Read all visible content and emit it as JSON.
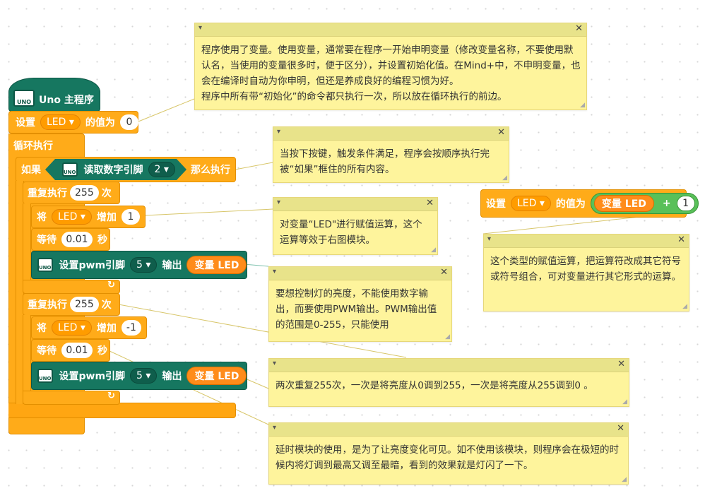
{
  "program": {
    "hat_title": "Uno 主程序",
    "board_label": "UNO",
    "set_var": {
      "set": "设置",
      "var": "LED",
      "value_of": "的值为",
      "value": "0"
    },
    "loop_label": "循环执行",
    "if_block": {
      "if": "如果",
      "read_digital": "读取数字引脚",
      "pin": "2",
      "then": "那么执行"
    },
    "repeat1": {
      "repeat": "重复执行",
      "count": "255",
      "times": "次",
      "change": {
        "label": "将",
        "var": "LED",
        "increase": "增加",
        "by": "1"
      },
      "wait": {
        "label": "等待",
        "value": "0.01",
        "unit": "秒"
      },
      "pwm": {
        "label": "设置pwm引脚",
        "pin": "5",
        "output": "输出",
        "var_reporter": "变量 LED"
      }
    },
    "repeat2": {
      "repeat": "重复执行",
      "count": "255",
      "times": "次",
      "change": {
        "label": "将",
        "var": "LED",
        "increase": "增加",
        "by": "-1"
      },
      "wait": {
        "label": "等待",
        "value": "0.01",
        "unit": "秒"
      },
      "pwm": {
        "label": "设置pwm引脚",
        "pin": "5",
        "output": "输出",
        "var_reporter": "变量 LED"
      }
    },
    "loop_arrow": "↻"
  },
  "standalone": {
    "set": "设置",
    "var": "LED",
    "value_of": "的值为",
    "var_reporter": "变量 LED",
    "op": "+",
    "num": "1"
  },
  "comments": {
    "c1": "程序使用了变量。使用变量，通常要在程序一开始申明变量（修改变量名称，不要使用默认名，当使用的变量很多时，便于区分），并设置初始化值。在Mind+中，不申明变量，也会在编译时自动为你申明，但还是养成良好的编程习惯为好。\n程序中所有带“初始化”的命令都只执行一次，所以放在循环执行的前边。",
    "c2": "当按下按键，触发条件满足，程序会按顺序执行完被“如果”框住的所有内容。",
    "c3": "对变量“LED\"进行赋值运算，这个运算等效于右图模块。",
    "c4": "这个类型的赋值运算，把运算符改成其它符号或符号组合，可对变量进行其它形式的运算。",
    "c5": "要想控制灯的亮度，不能使用数字输出，而要使用PWM输出。PWM输出值的范围是0-255，只能使用",
    "c6": "两次重复255次，一次是将亮度从0调到255，一次是将亮度从255调到0 。",
    "c7": "延时模块的使用，是为了让亮度变化可见。如不使用该模块，则程序会在极短的时候内将灯调到最高又调至最暗，看到的效果就是灯闪了一下。"
  },
  "icons": {
    "collapse": "▾",
    "close": "✕",
    "dropdown": "▾",
    "resize": "◢"
  },
  "colors": {
    "control_orange": "#ffab19",
    "board_teal": "#167760",
    "variable_orange": "#ff8c1a",
    "operator_green": "#59c059",
    "comment_bg": "#fef49c",
    "comment_bar": "#e8e38a"
  }
}
